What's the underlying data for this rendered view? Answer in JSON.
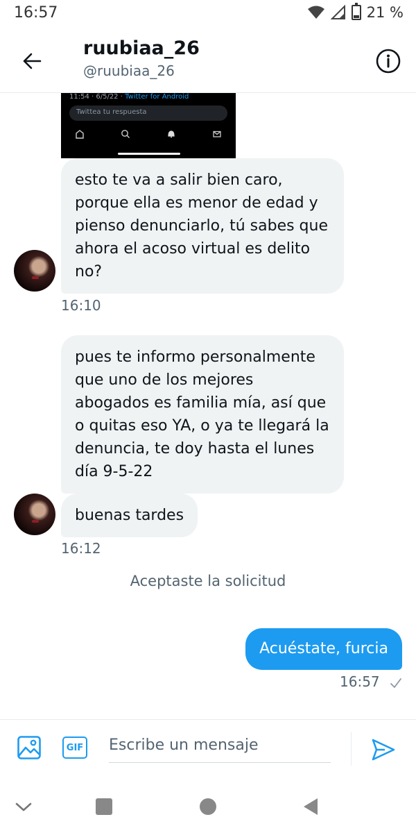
{
  "status_bar": {
    "time": "16:57",
    "battery": "21 %"
  },
  "header": {
    "name": "ruubiaa_26",
    "handle": "@ruubiaa_26"
  },
  "media_preview": {
    "meta_time": "11:54 · 6/5/22 · ",
    "meta_source": "Twitter for Android",
    "reply_placeholder": "Twittea tu respuesta"
  },
  "messages": [
    {
      "text": "esto te va a salir bien caro, porque ella es menor de edad y pienso denunciarlo, tú sabes que ahora el acoso virtual es delito no?"
    },
    {
      "text": "pues te informo personalmente que uno de los mejores abogados es familia mía, así que o quitas eso YA, o ya te llegará la denuncia, te doy hasta el lunes día 9-5-22"
    },
    {
      "text": "buenas tardes"
    },
    {
      "text": "Acuéstate, furcia"
    }
  ],
  "timestamps": {
    "first_group": "16:10",
    "second_group": "16:12",
    "sent": "16:57"
  },
  "system_note": "Aceptaste la solicitud",
  "composer": {
    "placeholder": "Escribe un mensaje",
    "gif_label": "GIF"
  },
  "colors": {
    "accent": "#1d9bf0",
    "bubble_in": "#eff3f4",
    "muted_text": "#536471"
  },
  "icons": {
    "back": "arrow-left-icon",
    "info": "info-icon",
    "image": "image-icon",
    "gif": "gif-icon",
    "send": "send-icon",
    "read": "check-icon"
  }
}
